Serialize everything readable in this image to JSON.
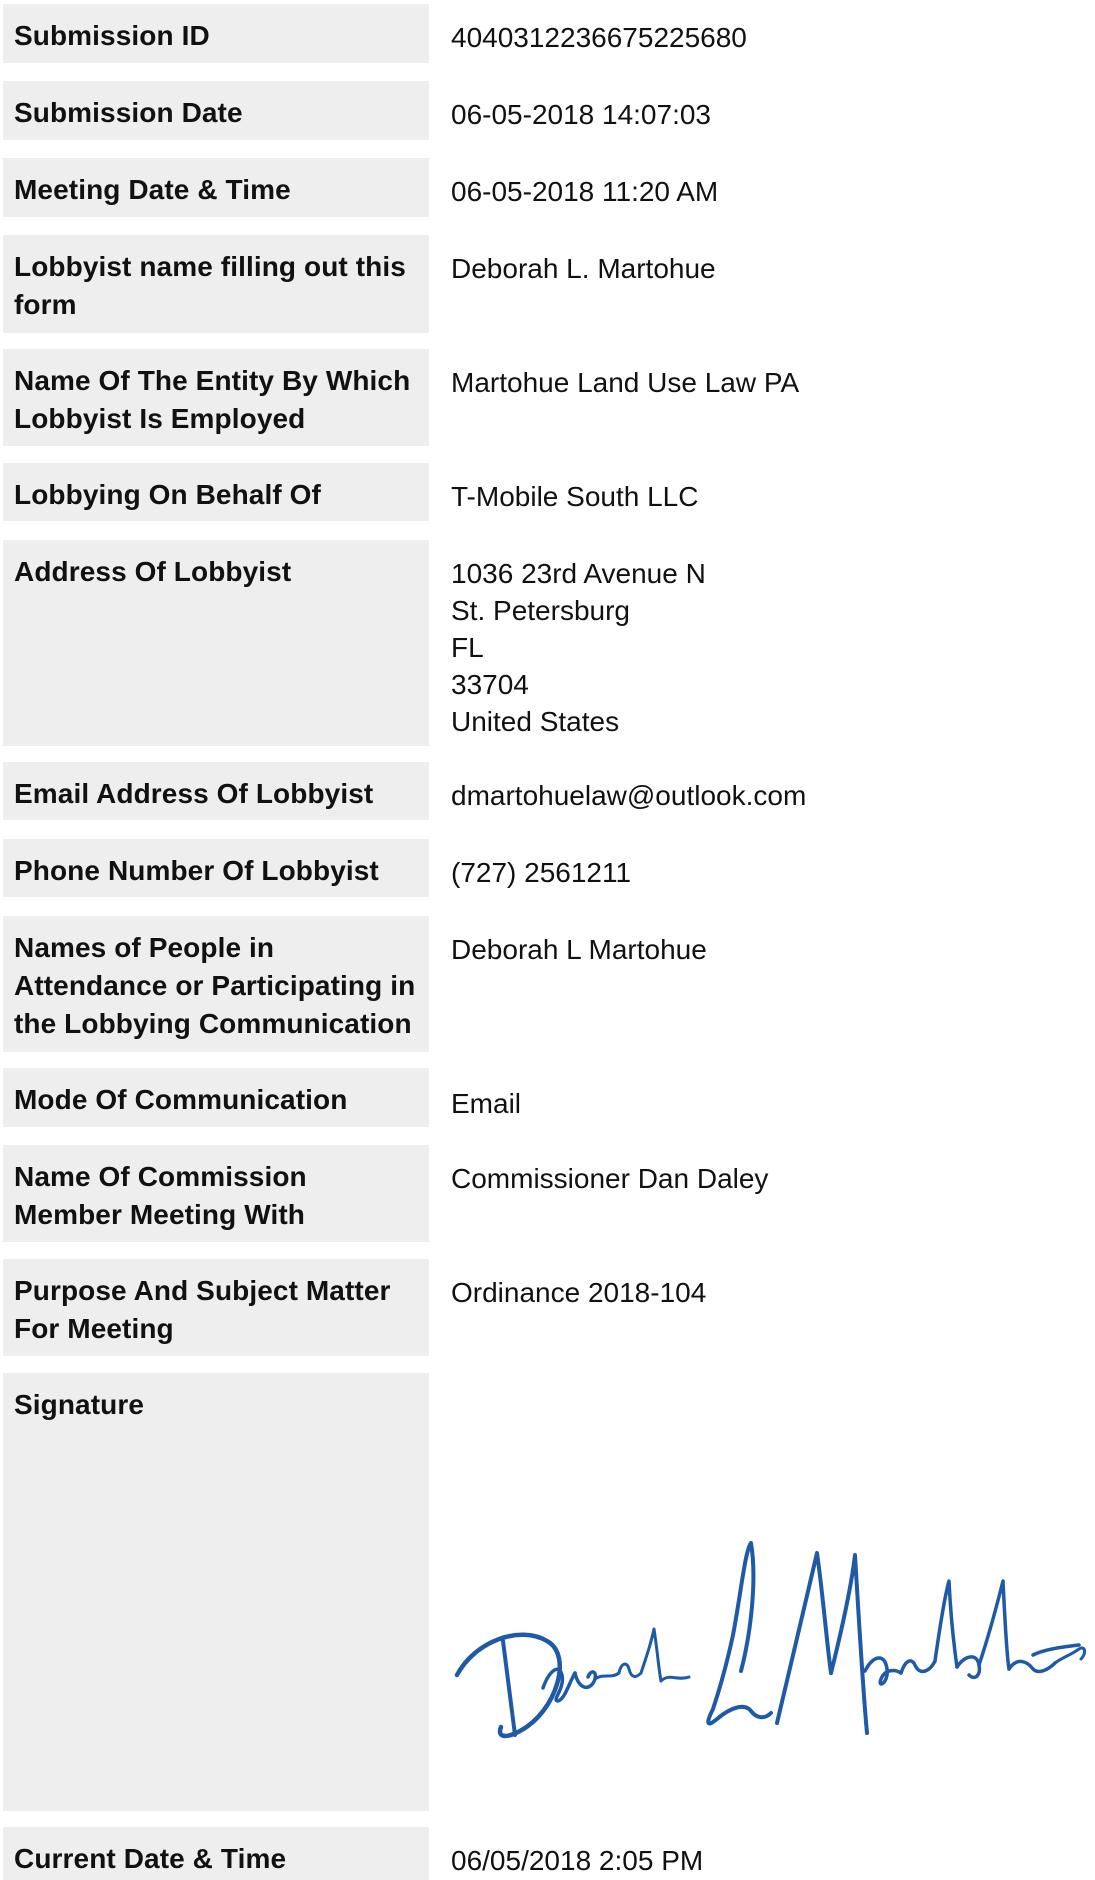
{
  "form": {
    "submission_id": {
      "label": "Submission ID",
      "value": "4040312236675225680"
    },
    "submission_date": {
      "label": "Submission Date",
      "value": "06-05-2018 14:07:03"
    },
    "meeting_datetime": {
      "label": "Meeting Date & Time",
      "value": "06-05-2018 11:20 AM"
    },
    "lobbyist_name": {
      "label": "Lobbyist name filling out this form",
      "value": "Deborah L. Martohue"
    },
    "employer": {
      "label": "Name Of The Entity By Which Lobbyist Is Employed",
      "value": "Martohue Land Use Law PA"
    },
    "on_behalf_of": {
      "label": "Lobbying On Behalf Of",
      "value": "T-Mobile South LLC"
    },
    "address": {
      "label": "Address Of Lobbyist",
      "street": "1036 23rd Avenue N",
      "city": "St. Petersburg",
      "state": "FL",
      "zip": "33704",
      "country": "United States"
    },
    "email": {
      "label": "Email Address Of Lobbyist",
      "value": "dmartohuelaw@outlook.com"
    },
    "phone": {
      "label": "Phone Number Of Lobbyist",
      "value": "(727) 2561211"
    },
    "attendees": {
      "label": "Names of People in Attendance or Participating in the Lobbying Communication",
      "value": "Deborah L Martohue"
    },
    "mode": {
      "label": "Mode Of Communication",
      "value": "Email"
    },
    "commission_member": {
      "label": "Name Of Commission Member Meeting With",
      "value": "Commissioner Dan Daley"
    },
    "purpose": {
      "label": "Purpose And Subject Matter For Meeting",
      "value": "Ordinance 2018-104"
    },
    "signature": {
      "label": "Signature",
      "ink_color": "#1f5aa6",
      "signed_name": "Deborah L Martohue"
    },
    "current_datetime": {
      "label": "Current Date & Time",
      "value": "06/05/2018 2:05 PM"
    }
  },
  "colors": {
    "label_background": "#eeeeee",
    "text": "#111111"
  }
}
